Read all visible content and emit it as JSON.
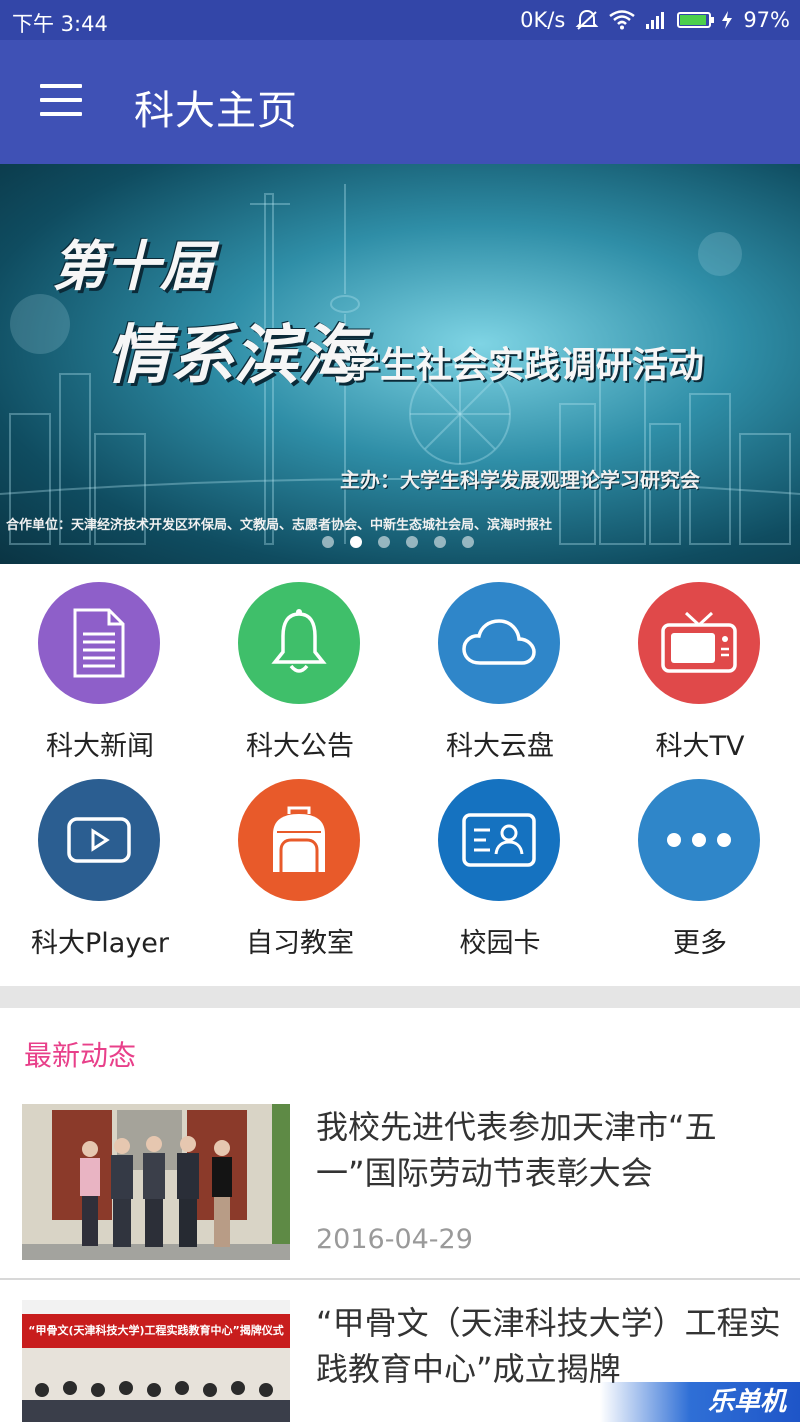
{
  "status_bar": {
    "time": "下午 3:44",
    "net_speed": "0K/s",
    "battery": "97%",
    "battery_level": 0.97,
    "icons": [
      "mute-icon",
      "wifi-icon",
      "signal-icon",
      "battery-icon",
      "charging-icon"
    ]
  },
  "app_bar": {
    "title": "科大主页",
    "menu_icon": "menu-icon"
  },
  "banner": {
    "line1": "第十届",
    "line2": "情系滨海",
    "line3": "学生社会实践调研活动",
    "host": "主办：大学生科学发展观理论学习研究会",
    "partners": "合作单位：天津经济技术开发区环保局、文教局、志愿者协会、中新生态城社会局、滨海时报社",
    "slide_count": 6,
    "active_slide": 2
  },
  "features": [
    {
      "label": "科大新闻",
      "icon": "news-document-icon",
      "color": "#8e5fc9"
    },
    {
      "label": "科大公告",
      "icon": "bell-icon",
      "color": "#3fbf6a"
    },
    {
      "label": "科大云盘",
      "icon": "cloud-icon",
      "color": "#2f86c9"
    },
    {
      "label": "科大TV",
      "icon": "tv-icon",
      "color": "#e0494a"
    },
    {
      "label": "科大Player",
      "icon": "play-icon",
      "color": "#2b5e91"
    },
    {
      "label": "自习教室",
      "icon": "backpack-icon",
      "color": "#e85a2a"
    },
    {
      "label": "校园卡",
      "icon": "id-card-icon",
      "color": "#1572c0"
    },
    {
      "label": "更多",
      "icon": "more-icon",
      "color": "#2f86c9"
    }
  ],
  "news": {
    "section_title": "最新动态",
    "items": [
      {
        "title": "我校先进代表参加天津市“五一”国际劳动节表彰大会",
        "date": "2016-04-29"
      },
      {
        "title": "“甲骨文（天津科技大学）工程实践教育中心”成立揭牌",
        "date": "",
        "photo_banner_text": "“甲骨文(天津科技大学)工程实践教育中心”揭牌仪式"
      }
    ]
  },
  "watermark": "乐单机"
}
